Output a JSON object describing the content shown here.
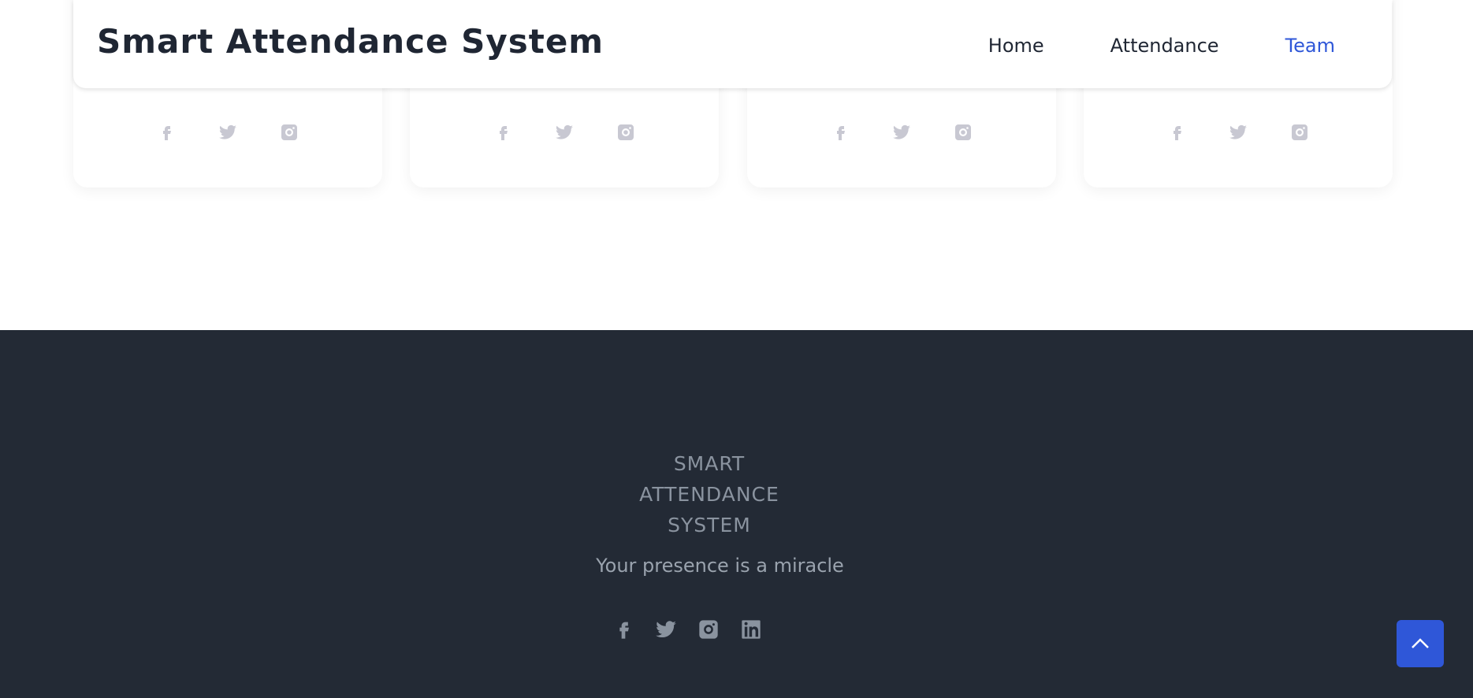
{
  "header": {
    "brand": "Smart Attendance System",
    "nav": [
      {
        "label": "Home",
        "active": false
      },
      {
        "label": "Attendance",
        "active": false
      },
      {
        "label": "Team",
        "active": true
      }
    ]
  },
  "team_cards": [
    {
      "social_icons": [
        "facebook-icon",
        "twitter-icon",
        "instagram-icon"
      ]
    },
    {
      "social_icons": [
        "facebook-icon",
        "twitter-icon",
        "instagram-icon"
      ]
    },
    {
      "social_icons": [
        "facebook-icon",
        "twitter-icon",
        "instagram-icon"
      ]
    },
    {
      "social_icons": [
        "facebook-icon",
        "twitter-icon",
        "instagram-icon"
      ]
    }
  ],
  "footer": {
    "logo_line1": "SMART",
    "logo_line2": "ATTENDANCE",
    "logo_line3": "SYSTEM",
    "tagline": "Your presence is a miracle",
    "social_icons": [
      "facebook-icon",
      "twitter-icon",
      "instagram-icon",
      "linkedin-icon"
    ]
  },
  "scroll_top": {
    "icon": "chevron-up-icon"
  },
  "colors": {
    "accent": "#2f57d8",
    "footer_bg": "#232a35",
    "text_dark": "#1f2633"
  }
}
